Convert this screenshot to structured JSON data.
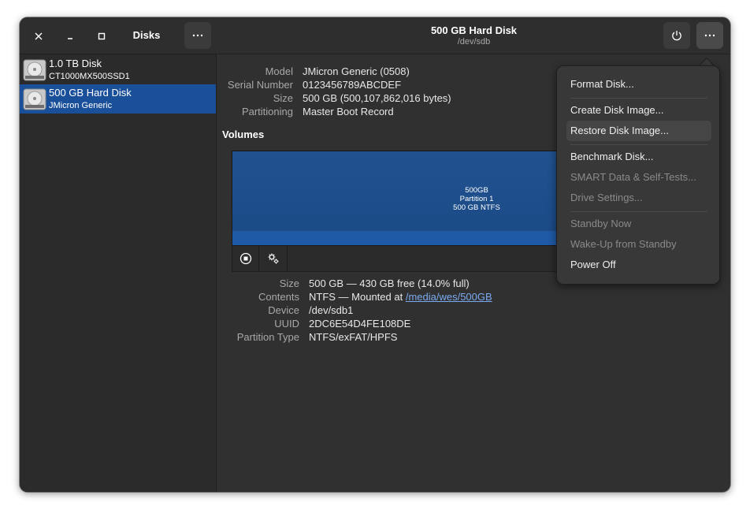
{
  "sidebar": {
    "title": "Disks",
    "window_controls": {
      "close": "×",
      "minimize": "–",
      "maximize": "□"
    },
    "disks": [
      {
        "name": "1.0 TB Disk",
        "subtitle": "CT1000MX500SSD1"
      },
      {
        "name": "500 GB Hard Disk",
        "subtitle": "JMicron Generic"
      }
    ]
  },
  "header": {
    "title": "500 GB Hard Disk",
    "subtitle": "/dev/sdb"
  },
  "drive_info": {
    "model_label": "Model",
    "model": "JMicron Generic (0508)",
    "serial_label": "Serial Number",
    "serial": "0123456789ABCDEF",
    "size_label": "Size",
    "size": "500 GB (500,107,862,016 bytes)",
    "partitioning_label": "Partitioning",
    "partitioning": "Master Boot Record"
  },
  "volumes": {
    "title": "Volumes",
    "graph_lines": [
      "500GB",
      "Partition 1",
      "500 GB NTFS"
    ]
  },
  "partition_info": {
    "size_label": "Size",
    "size": "500 GB — 430 GB free (14.0% full)",
    "contents_label": "Contents",
    "contents_prefix": "NTFS — Mounted at ",
    "mount_link": "/media/wes/500GB",
    "device_label": "Device",
    "device": "/dev/sdb1",
    "uuid_label": "UUID",
    "uuid": "2DC6E54D4FE108DE",
    "type_label": "Partition Type",
    "type": "NTFS/exFAT/HPFS"
  },
  "menu": {
    "format": "Format Disk...",
    "create_image": "Create Disk Image...",
    "restore_image": "Restore Disk Image...",
    "benchmark": "Benchmark Disk...",
    "smart": "SMART Data & Self-Tests...",
    "drive_settings": "Drive Settings...",
    "standby": "Standby Now",
    "wakeup": "Wake-Up from Standby",
    "power_off": "Power Off"
  },
  "colors": {
    "selection": "#1a4f99",
    "volume_fill": "#21528f",
    "link": "#7aaaf0"
  }
}
